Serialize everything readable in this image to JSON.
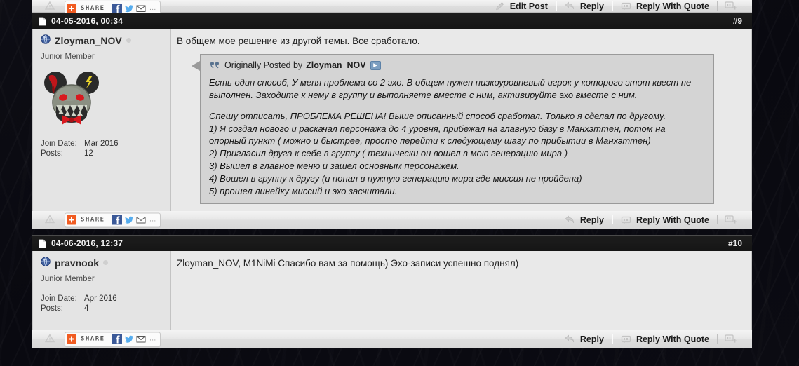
{
  "top_bar": {
    "actions": [
      {
        "label": "Edit Post",
        "icon": "pencil-icon"
      },
      {
        "label": "Reply",
        "icon": "reply-arrow-icon"
      },
      {
        "label": "Reply With Quote",
        "icon": "quote-bubble-icon"
      },
      {
        "label": "",
        "icon": "multiquote-plus-icon"
      }
    ]
  },
  "share_widget": {
    "label": "SHARE",
    "plus_icon": "addthis-plus-icon",
    "facebook_icon": "facebook-icon",
    "twitter_icon": "twitter-icon",
    "email_icon": "email-icon",
    "more": "…",
    "warn_icon": "warning-triangle-icon"
  },
  "footer_actions": [
    {
      "label": "Reply",
      "icon": "reply-arrow-icon"
    },
    {
      "label": "Reply With Quote",
      "icon": "quote-bubble-icon"
    },
    {
      "label": "",
      "icon": "multiquote-plus-icon"
    }
  ],
  "posts": [
    {
      "date": "04-05-2016, 00:34",
      "number": "#9",
      "doc_icon": "post-document-icon",
      "user": {
        "name": "Zloyman_NOV",
        "status_icon": "online-status-globe-icon",
        "title": "Junior Member",
        "avatar_icon": "zombie-mouse-avatar",
        "join_label": "Join Date:",
        "join_value": "Mar 2016",
        "posts_label": "Posts:",
        "posts_value": "12"
      },
      "text": "В общем мое решение из другой темы. Все сработало.",
      "quote": {
        "icon": "quote-marks-icon",
        "prefix": "Originally Posted by",
        "author": "Zloyman_NOV",
        "jump_icon": "view-post-icon",
        "paragraph1": "Есть один способ, У меня проблема со 2 эхо. В общем нужен низкоуровневый игрок у которого этот квест не выполнен. Заходите к нему в группу и выполняете вместе с ним, активируйте эхо вместе с ним.",
        "paragraph2_lines": [
          "Спешу отписать, ПРОБЛЕМА РЕШЕНА! Выше описанный способ сработал. Только я сделал по другому.",
          "1) Я создал нового и раскачал персонажа до 4 уровня, прибежал на главную базу в Манхэттен, потом на опорный пункт ( можно и быстрее, просто перейти к следующему шагу по прибытии в Манхэттен)",
          "2) Пригласил друга к себе в группу ( технически он вошел в мою генерацию мира )",
          "3) Вышел в главное меню и зашел основным персонажем.",
          "4) Вошел в группу к другу (и попал в нужную генерацию мира где миссия не пройдена)",
          "5) прошел линейку миссий и эхо засчитали."
        ]
      }
    },
    {
      "date": "04-06-2016, 12:37",
      "number": "#10",
      "doc_icon": "post-document-icon",
      "user": {
        "name": "pravnook",
        "status_icon": "online-status-globe-icon",
        "title": "Junior Member",
        "avatar_icon": "none",
        "join_label": "Join Date:",
        "join_value": "Apr 2016",
        "posts_label": "Posts:",
        "posts_value": "4"
      },
      "text": "Zloyman_NOV, M1NiMi Спасибо вам за помощь) Эхо-записи успешно поднял)"
    }
  ],
  "colors": {
    "page_bg": "#0a0a10",
    "post_head_bg": "#1d1d1d",
    "post_body_bg": "#e9e9e9",
    "quote_bg": "#d4d4d4",
    "accent_orange": "#f15c22"
  }
}
